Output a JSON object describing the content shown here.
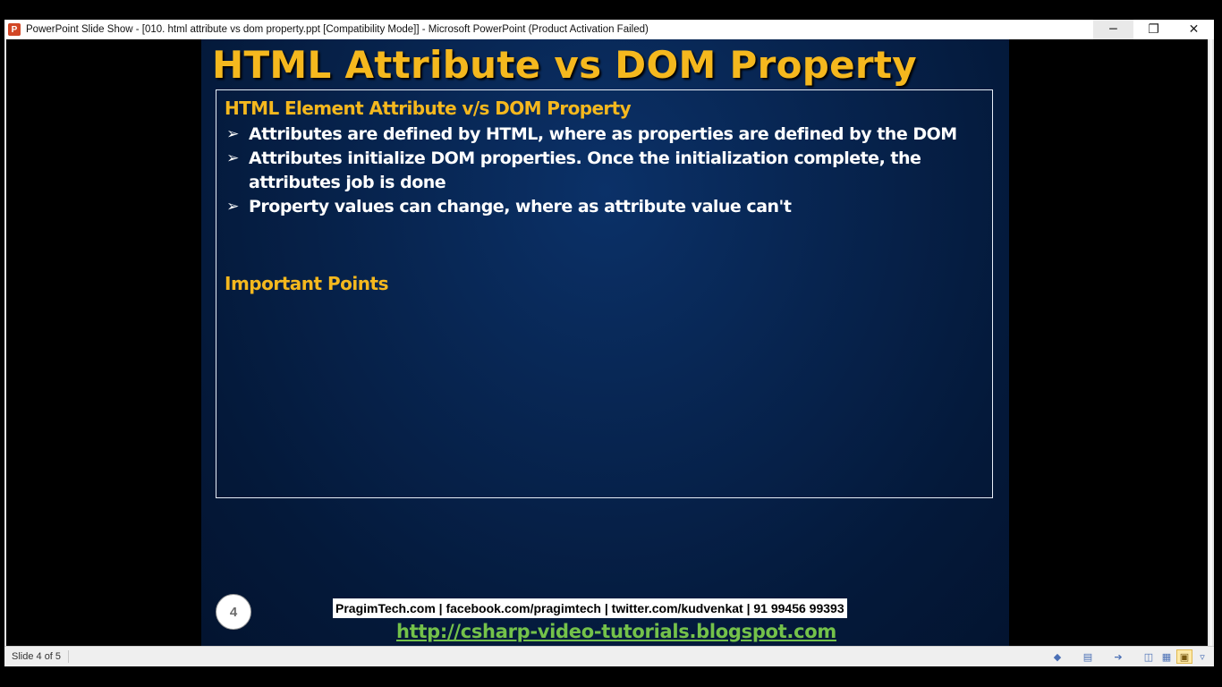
{
  "window": {
    "title": "PowerPoint Slide Show - [010. html attribute vs dom property.ppt [Compatibility Mode]] - Microsoft PowerPoint (Product Activation Failed)",
    "app_icon_letter": "P",
    "controls": {
      "minimize": "─",
      "restore": "❐",
      "close": "✕"
    }
  },
  "slide": {
    "title": "HTML Attribute vs DOM Property",
    "sub_heading": "HTML Element Attribute v/s DOM Property",
    "bullet_marker": "➢",
    "bullets": [
      "Attributes are defined by HTML, where as properties are defined by the DOM",
      "Attributes initialize DOM properties. Once the initialization complete, the attributes job is done",
      "Property values can change, where as attribute value can't"
    ],
    "important_heading": "Important Points",
    "slide_number": "4",
    "contact": "PragimTech.com | facebook.com/pragimtech  | twitter.com/kudvenkat  | 91 99456 99393",
    "blog_url": "http://csharp-video-tutorials.blogspot.com"
  },
  "statusbar": {
    "slide_indicator": "Slide 4 of 5",
    "icons": [
      "previous-icon",
      "notes-icon",
      "next-icon",
      "normal-view-icon",
      "slide-sorter-icon",
      "reading-view-icon",
      "menu-icon"
    ]
  },
  "colors": {
    "title_gold": "#f5b81e",
    "slide_bg": "#07244f",
    "link_green": "#74c24a",
    "app_icon": "#d24726"
  }
}
